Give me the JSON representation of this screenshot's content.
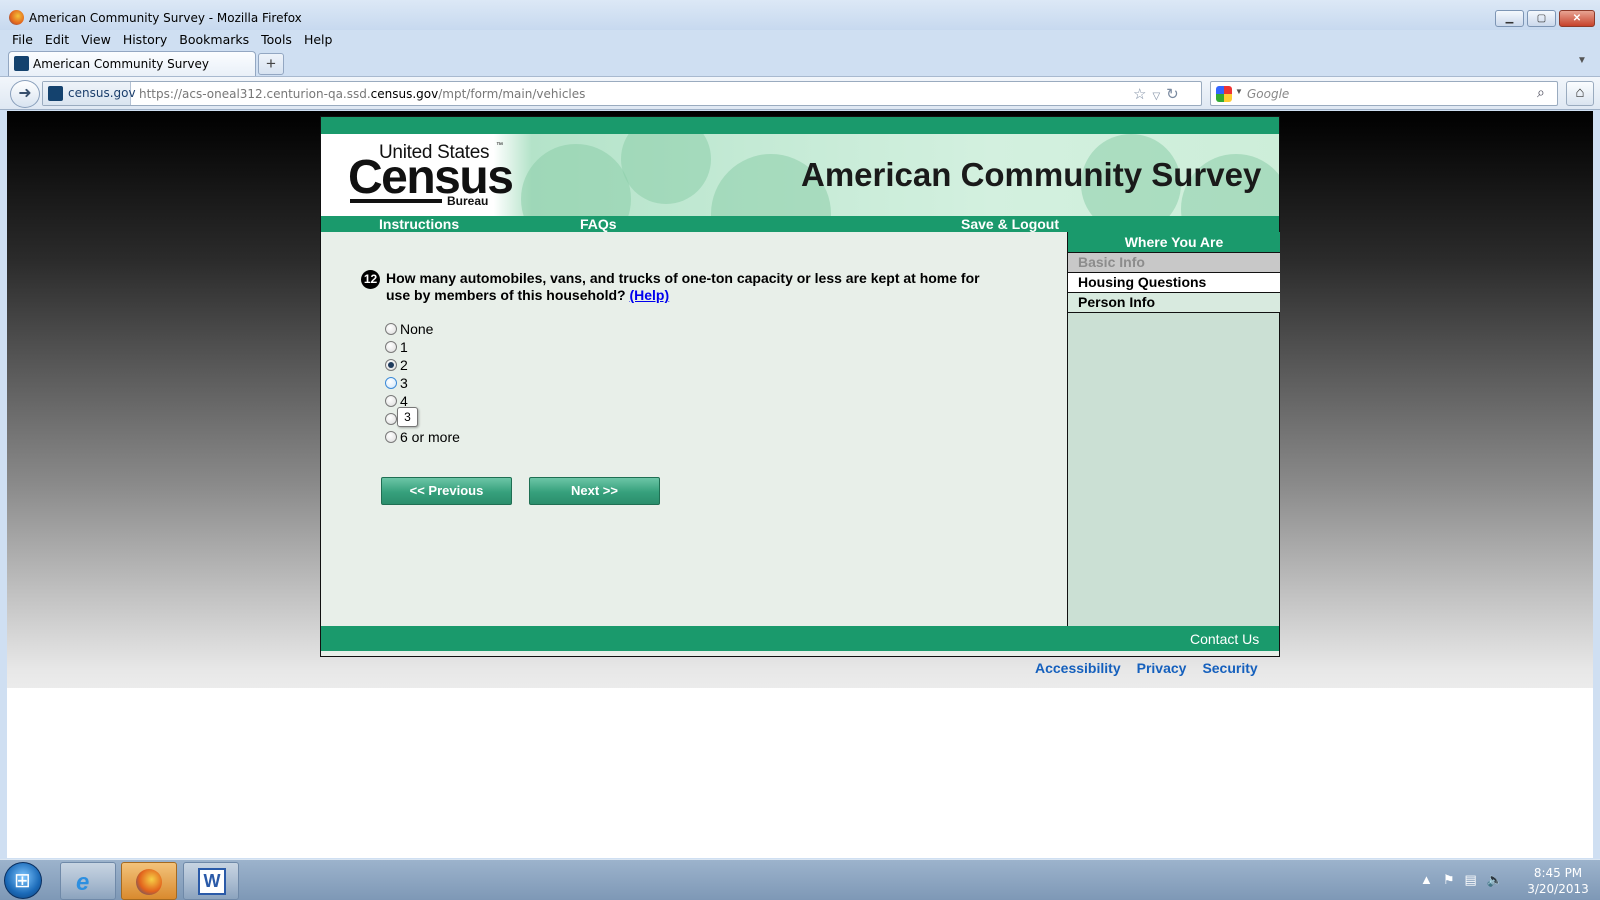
{
  "window": {
    "title": "American Community Survey - Mozilla Firefox",
    "minimize_icon": "minimize-icon",
    "maximize_icon": "maximize-icon",
    "close_label": "✕"
  },
  "menubar": [
    "File",
    "Edit",
    "View",
    "History",
    "Bookmarks",
    "Tools",
    "Help"
  ],
  "tabs": [
    {
      "label": "American Community Survey",
      "active": true
    }
  ],
  "new_tab_label": "+",
  "navbar": {
    "site_identity": "census.gov",
    "url_prefix": "https://acs-oneal312.centurion-qa.ssd.",
    "url_domain": "census.gov",
    "url_suffix": "/mpt/form/main/vehicles",
    "search_placeholder": "Google"
  },
  "header": {
    "logo_line1": "United States",
    "logo_tm": "™",
    "logo_main": "Census",
    "logo_bureau": "Bureau",
    "title": "American Community Survey"
  },
  "nav": {
    "instructions": "Instructions",
    "faqs": "FAQs",
    "save_logout": "Save & Logout"
  },
  "question": {
    "number": "12",
    "text": "How many automobiles, vans, and trucks of one-ton capacity or less are kept at home for use by members of this household?",
    "help": "(Help)",
    "options": [
      "None",
      "1",
      "2",
      "3",
      "4",
      "5",
      "6 or more"
    ],
    "selected": "2",
    "tooltip": "3"
  },
  "buttons": {
    "previous": "<<   Previous",
    "next": "Next   >>"
  },
  "sidebar": {
    "heading": "Where You Are",
    "items": [
      {
        "label": "Basic Info",
        "state": "disabled"
      },
      {
        "label": "Housing Questions",
        "state": "current"
      },
      {
        "label": "Person Info",
        "state": "normal"
      }
    ]
  },
  "footer": {
    "contact": "Contact Us",
    "links": [
      "Accessibility",
      "Privacy",
      "Security"
    ]
  },
  "taskbar": {
    "time": "8:45 PM",
    "date": "3/20/2013",
    "word_icon": "W"
  },
  "colors": {
    "brand_green": "#1a9a6c",
    "link_blue": "#1560bd",
    "sidebar_bg": "#cbe0d4"
  }
}
